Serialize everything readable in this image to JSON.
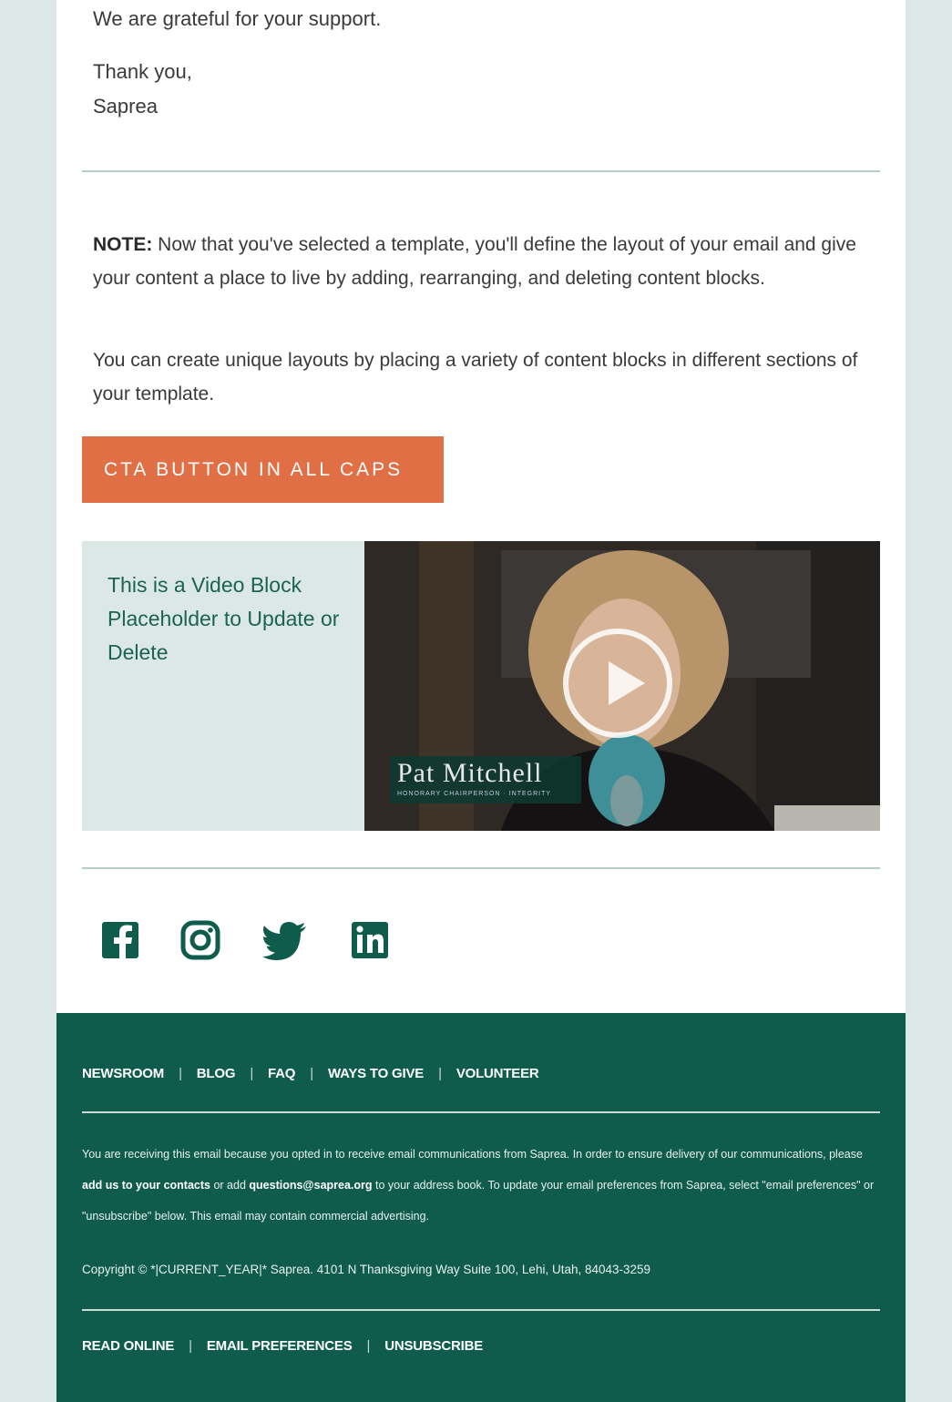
{
  "letter": {
    "grateful": "We are grateful for your support.",
    "thank_you": "Thank you,",
    "signature": "Saprea"
  },
  "note": {
    "label": "NOTE:",
    "text": " Now that you've selected a template, you'll define the layout of your email and give your content a place to live by adding, rearranging, and deleting content blocks.",
    "layouts": "You can create unique layouts by placing a variety of content blocks in different sections of your template."
  },
  "cta": {
    "label": "CTA BUTTON IN ALL CAPS",
    "color": "#e06f45"
  },
  "video": {
    "caption": "This is a Video Block Placeholder to Update or Delete",
    "name": "Pat Mitchell",
    "title": "HONORARY CHAIRPERSON · INTEGRITY"
  },
  "social": {
    "icons": [
      "facebook-icon",
      "instagram-icon",
      "twitter-icon",
      "linkedin-icon"
    ],
    "color": "#0f5c4d"
  },
  "footer": {
    "background": "#0f5c4d",
    "nav": [
      "NEWSROOM",
      "BLOG",
      "FAQ",
      "WAYS TO GIVE",
      "VOLUNTEER"
    ],
    "separator": "|",
    "disclaimer_part1": "You are receiving this email because you opted in to receive email communications from Saprea. In order to ensure delivery of our communications, please ",
    "disclaimer_link1": "add us to your contacts",
    "disclaimer_part2": " or add ",
    "disclaimer_link2": "questions@saprea.org",
    "disclaimer_part3": " to your address book. To update your email preferences from Saprea, select \"email preferences\" or \"unsubscribe\" below.  This email may contain commercial advertising.",
    "copyright": "Copyright © *|CURRENT_YEAR|* Saprea. 4101 N Thanksgiving Way Suite 100, Lehi, Utah, 84043-3259",
    "bottom_links": [
      "READ ONLINE",
      "EMAIL PREFERENCES",
      "UNSUBSCRIBE"
    ]
  }
}
